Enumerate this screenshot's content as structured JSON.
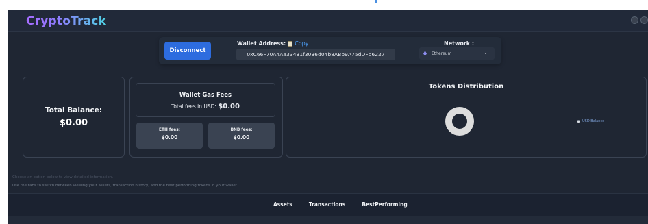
{
  "app": {
    "title": "CryptoTrack"
  },
  "wallet": {
    "disconnect_label": "Disconnect",
    "address_label": "Wallet Address:",
    "copy_label": "Copy",
    "address": "0xC66F70A4Aa33431f3036d04b8ABb9A75dDFb6227",
    "network_label": "Network :",
    "network_selected": "Ethereum"
  },
  "balance": {
    "label": "Total Balance:",
    "value": "$0.00"
  },
  "gas": {
    "title": "Wallet Gas Fees",
    "total_prefix": "Total fees in USD: ",
    "total_value": "$0.00",
    "eth_label": "ETH fees:",
    "eth_value": "$0.00",
    "bnb_label": "BNB fees:",
    "bnb_value": "$0.00"
  },
  "distribution": {
    "title": "Tokens Distribution",
    "legend_label": "USD Balance"
  },
  "hints": {
    "line1": "Choose an option below to view detailed information.",
    "line2": "Use the tabs to switch between viewing your assets, transaction history, and the best performing tokens in your wallet."
  },
  "tabs": [
    {
      "label": "Assets"
    },
    {
      "label": "Transactions"
    },
    {
      "label": "BestPerforming"
    }
  ],
  "colors": {
    "background": "#1f2633",
    "accent_button": "#2d6cdf",
    "copy_link": "#4ea3ff",
    "donut": "#dcdcdc"
  }
}
